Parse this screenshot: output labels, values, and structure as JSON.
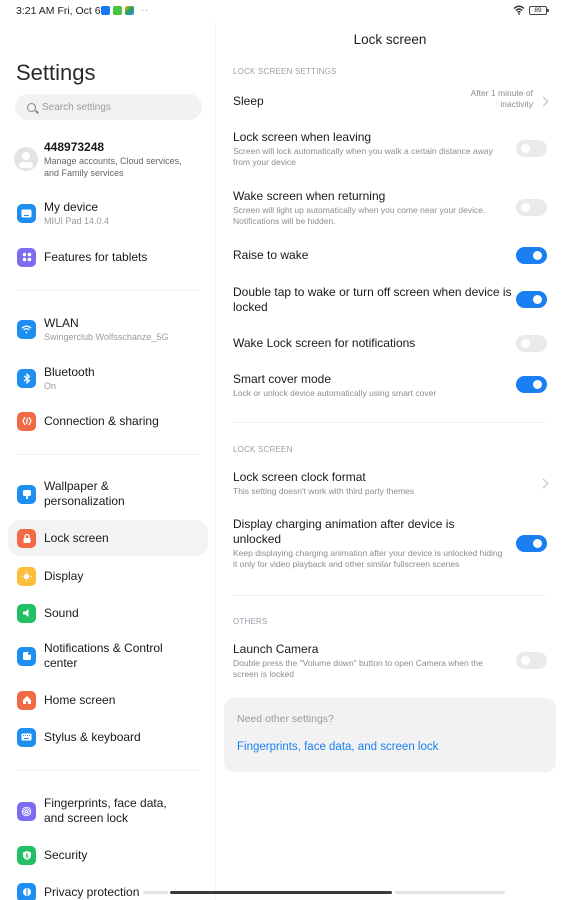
{
  "status_bar": {
    "time": "3:21 AM Fri, Oct 6",
    "notification_icons": [
      "facebook-icon",
      "wechat-icon",
      "app-icon"
    ],
    "more": "··",
    "battery": "89"
  },
  "sidebar": {
    "title": "Settings",
    "search_placeholder": "Search settings",
    "account": {
      "name": "448973248",
      "subtitle": "Manage accounts, Cloud services, and Family services"
    },
    "items": [
      {
        "label": "My device",
        "sub": "MIUI Pad 14.0.4",
        "icon": "device-icon",
        "color": "#1e8ff0"
      },
      {
        "label": "Features for tablets",
        "sub": "",
        "icon": "grid-icon",
        "color": "#7b6cf0"
      },
      {
        "label": "WLAN",
        "sub": "Swingerclub Wolfsschanze_5G",
        "icon": "wifi-icon",
        "color": "#1e8ff0"
      },
      {
        "label": "Bluetooth",
        "sub": "On",
        "icon": "bluetooth-icon",
        "color": "#1e8ff0"
      },
      {
        "label": "Connection & sharing",
        "sub": "",
        "icon": "connection-icon",
        "color": "#f06a45"
      },
      {
        "label": "Wallpaper & personalization",
        "sub": "",
        "icon": "wallpaper-icon",
        "color": "#1e8ff0"
      },
      {
        "label": "Lock screen",
        "sub": "",
        "icon": "lock-icon",
        "color": "#f06a45",
        "active": true
      },
      {
        "label": "Display",
        "sub": "",
        "icon": "sun-icon",
        "color": "#fbbd3a"
      },
      {
        "label": "Sound",
        "sub": "",
        "icon": "speaker-icon",
        "color": "#22c064"
      },
      {
        "label": "Notifications & Control center",
        "sub": "",
        "icon": "notification-icon",
        "color": "#1e8ff0"
      },
      {
        "label": "Home screen",
        "sub": "",
        "icon": "home-icon",
        "color": "#f06a45"
      },
      {
        "label": "Stylus & keyboard",
        "sub": "",
        "icon": "keyboard-icon",
        "color": "#1e8ff0"
      },
      {
        "label": "Fingerprints, face data, and screen lock",
        "sub": "",
        "icon": "fingerprint-icon",
        "color": "#7b6cf0"
      },
      {
        "label": "Security",
        "sub": "",
        "icon": "shield-icon",
        "color": "#22c064"
      },
      {
        "label": "Privacy protection",
        "sub": "",
        "icon": "privacy-icon",
        "color": "#1e8ff0"
      }
    ]
  },
  "main": {
    "title": "Lock screen",
    "sections": [
      {
        "header": "LOCK SCREEN SETTINGS"
      },
      {
        "header": "LOCK SCREEN"
      },
      {
        "header": "OTHERS"
      }
    ],
    "rows": {
      "sleep": {
        "title": "Sleep",
        "value": "After 1 minute of inactivity"
      },
      "lock_when_leaving": {
        "title": "Lock screen when leaving",
        "sub": "Screen will lock automatically when you walk a certain distance away from your device",
        "on": false
      },
      "wake_when_returning": {
        "title": "Wake screen when returning",
        "sub": "Screen will light up automatically when you come near your device. Notifications will be hidden.",
        "on": false
      },
      "raise_to_wake": {
        "title": "Raise to wake",
        "on": true
      },
      "double_tap": {
        "title": "Double tap to wake or turn off screen when device is locked",
        "on": true
      },
      "wake_for_notifications": {
        "title": "Wake Lock screen for notifications",
        "on": false
      },
      "smart_cover": {
        "title": "Smart cover mode",
        "sub": "Lock or unlock device automatically using smart cover",
        "on": true
      },
      "clock_format": {
        "title": "Lock screen clock format",
        "sub": "This setting doesn't work with third party themes"
      },
      "charging_animation": {
        "title": "Display charging animation after device is unlocked",
        "sub": "Keep displaying charging animation after your device is unlocked hiding it only for video playback and other similar fullscreen scenes",
        "on": true
      },
      "launch_camera": {
        "title": "Launch Camera",
        "sub": "Double press the \"Volume down\" button to open Camera when the screen is locked",
        "on": false
      }
    },
    "card": {
      "question": "Need other settings?",
      "link": "Fingerprints, face data, and screen lock"
    }
  },
  "colors": {
    "accent": "#1a7ff0",
    "toggle_off": "#eaeaea"
  }
}
